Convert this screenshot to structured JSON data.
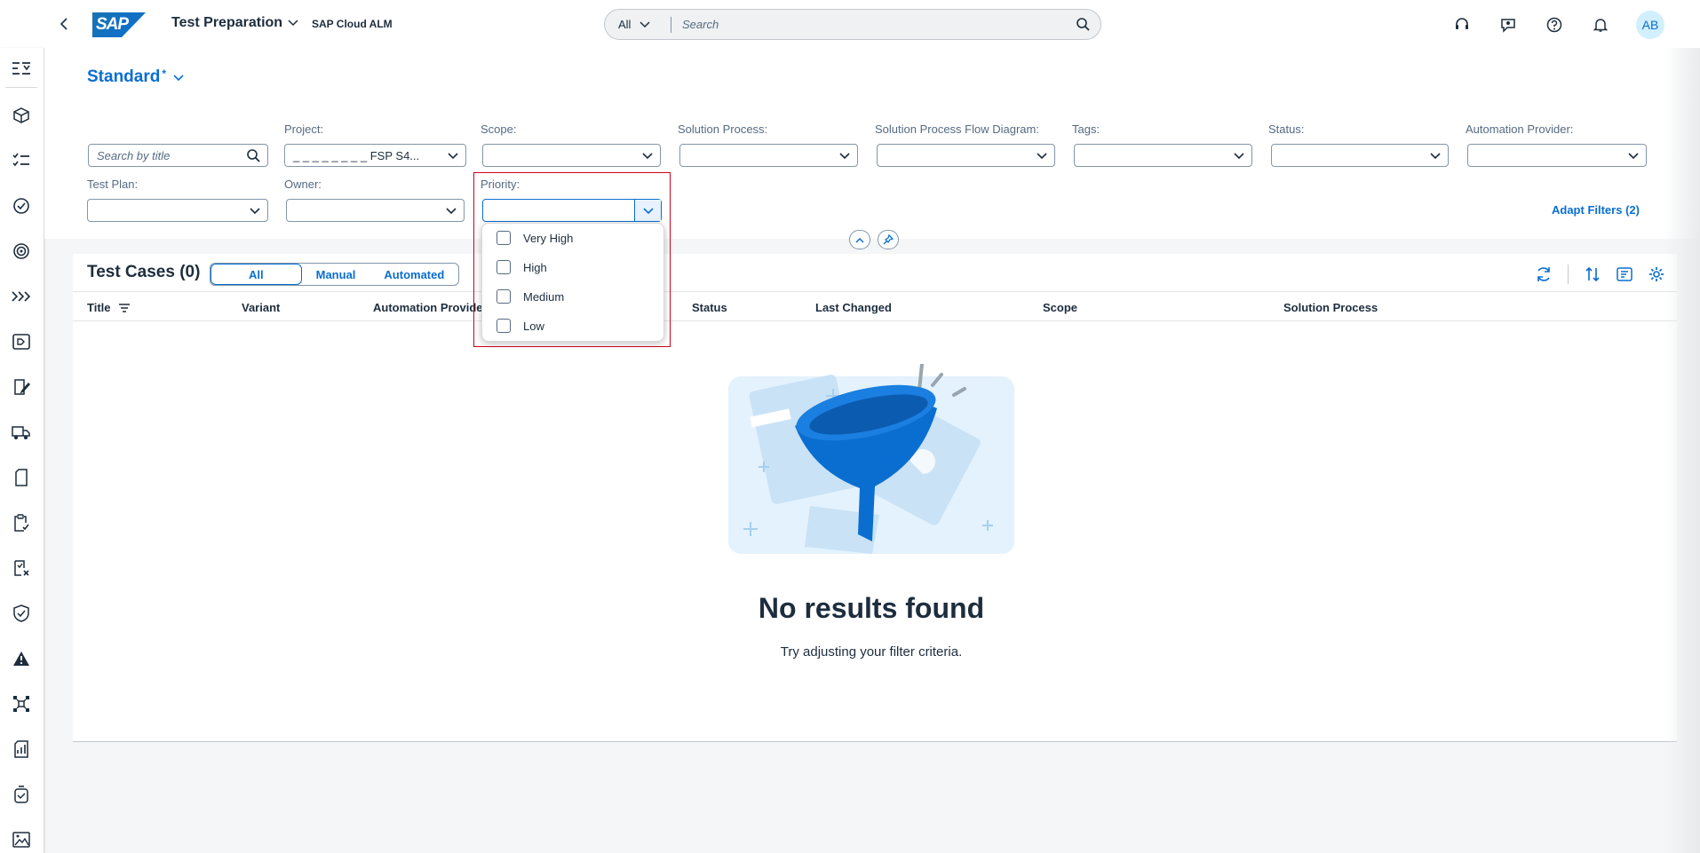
{
  "shell": {
    "logo": "SAP",
    "app_title": "Test Preparation",
    "app_subtitle": "SAP Cloud ALM",
    "search_scope": "All",
    "search_placeholder": "Search",
    "avatar_initials": "AB",
    "icons": [
      "headset-icon",
      "feedback-icon",
      "help-icon",
      "notification-icon"
    ]
  },
  "variant": {
    "name": "Standard",
    "modified_marker": "*"
  },
  "filters": {
    "search_placeholder": "Search by title",
    "project_label": "Project:",
    "project_value": "_ _ _ _ _ _ _ _ FSP S4...",
    "scope_label": "Scope:",
    "solution_process_label": "Solution Process:",
    "flow_diagram_label": "Solution Process Flow Diagram:",
    "tags_label": "Tags:",
    "status_label": "Status:",
    "automation_provider_label": "Automation Provider:",
    "test_plan_label": "Test Plan:",
    "owner_label": "Owner:",
    "priority_label": "Priority:",
    "adapt_filters": "Adapt Filters (2)"
  },
  "priority_options": [
    "Very High",
    "High",
    "Medium",
    "Low"
  ],
  "table": {
    "title": "Test Cases (0)",
    "segments": [
      "All",
      "Manual",
      "Automated"
    ],
    "active_segment": "All",
    "columns": [
      "Title",
      "Variant",
      "Automation Provide",
      "Status",
      "Last Changed",
      "Scope",
      "Solution Process"
    ],
    "empty_title": "No results found",
    "empty_text": "Try adjusting your filter criteria."
  },
  "colors": {
    "accent": "#0a6ed1",
    "highlight": "#d0021b"
  }
}
